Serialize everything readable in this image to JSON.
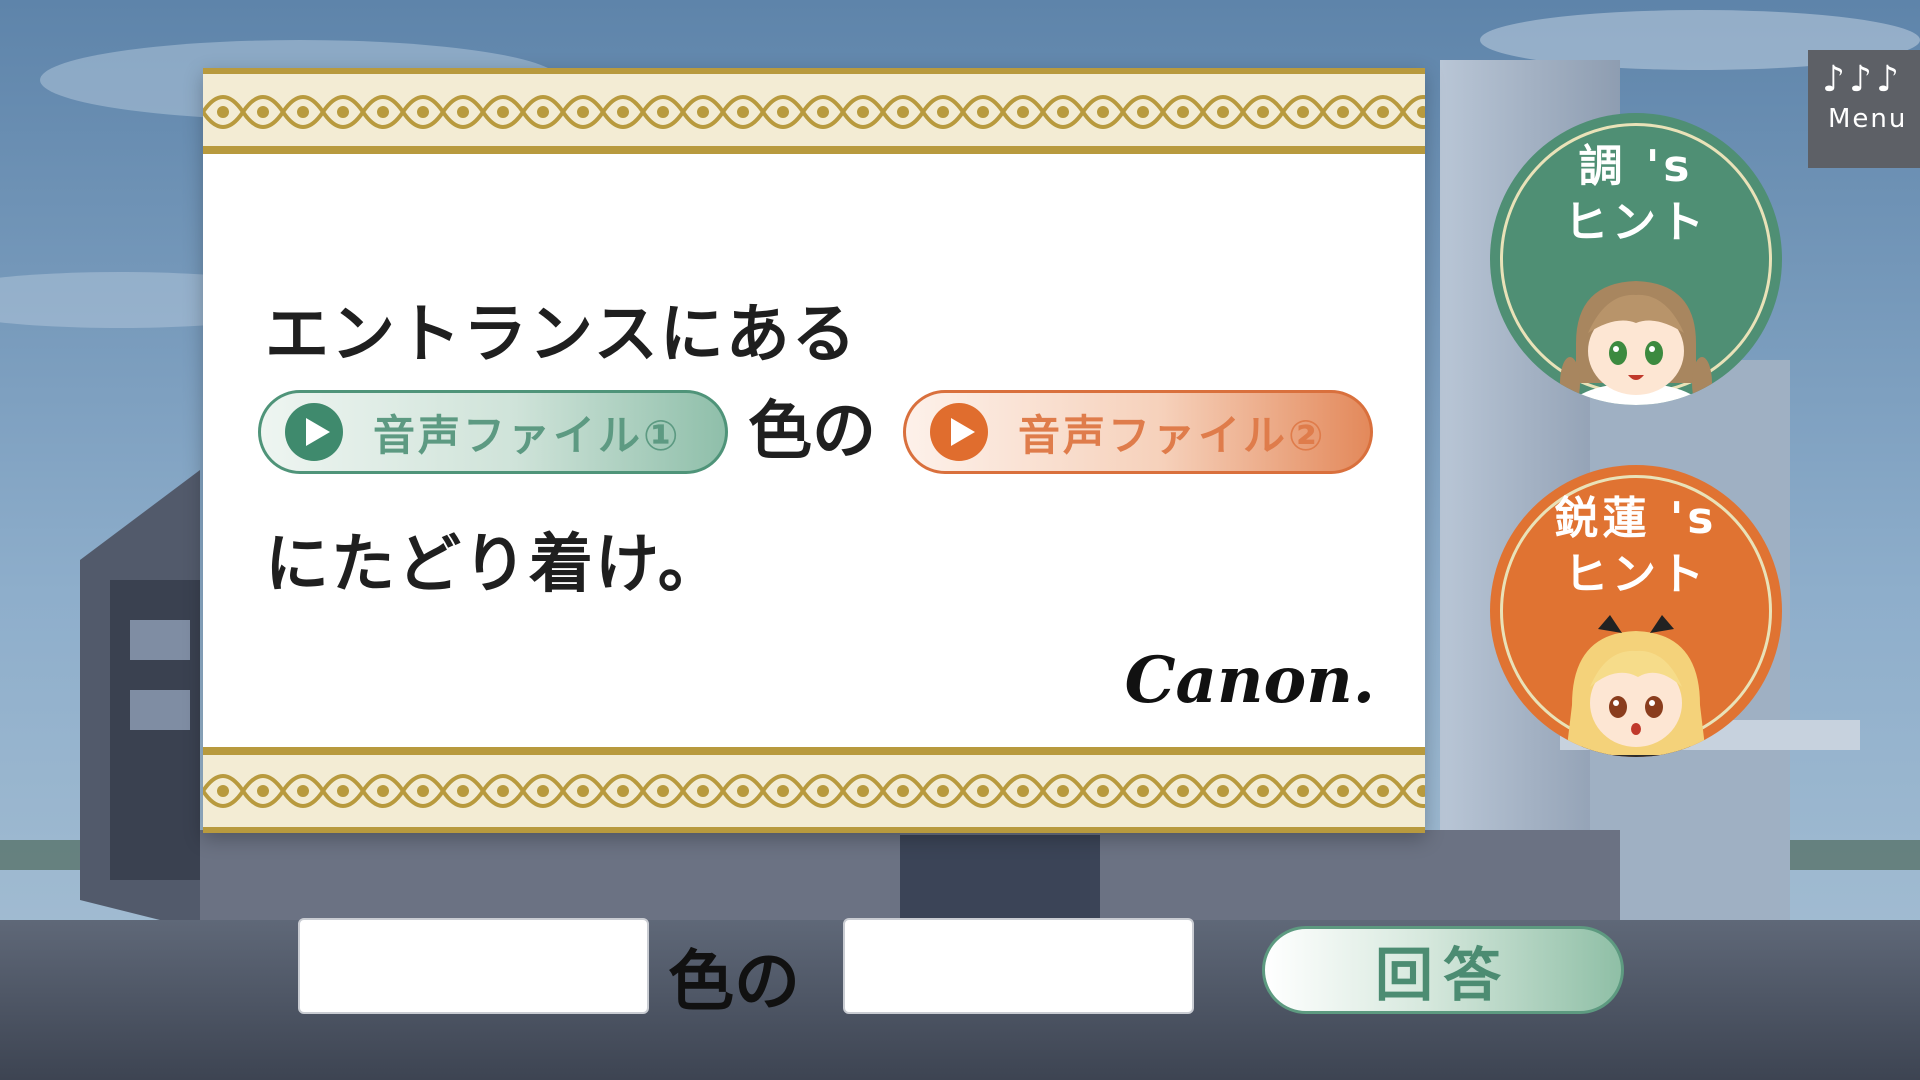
{
  "puzzle": {
    "line1": "エントランスにある",
    "audio1_label": "音声ファイル①",
    "middle": "色の",
    "audio2_label": "音声ファイル②",
    "line3": "にたどり着け。",
    "signature": "Canon."
  },
  "menu": {
    "notes": "♪♪♪",
    "label": "Menu"
  },
  "hints": [
    {
      "title_line1": "調 's",
      "title_line2": "ヒント",
      "color": "#4f8f74"
    },
    {
      "title_line1": "鋭蓮 's",
      "title_line2": "ヒント",
      "color": "#e07332"
    }
  ],
  "answer": {
    "first_value": "",
    "connector": "色の",
    "second_value": "",
    "submit_label": "回答"
  },
  "colors": {
    "green_accent": "#4f9479",
    "orange_accent": "#d9703d",
    "gold_border": "#b89a3e"
  }
}
